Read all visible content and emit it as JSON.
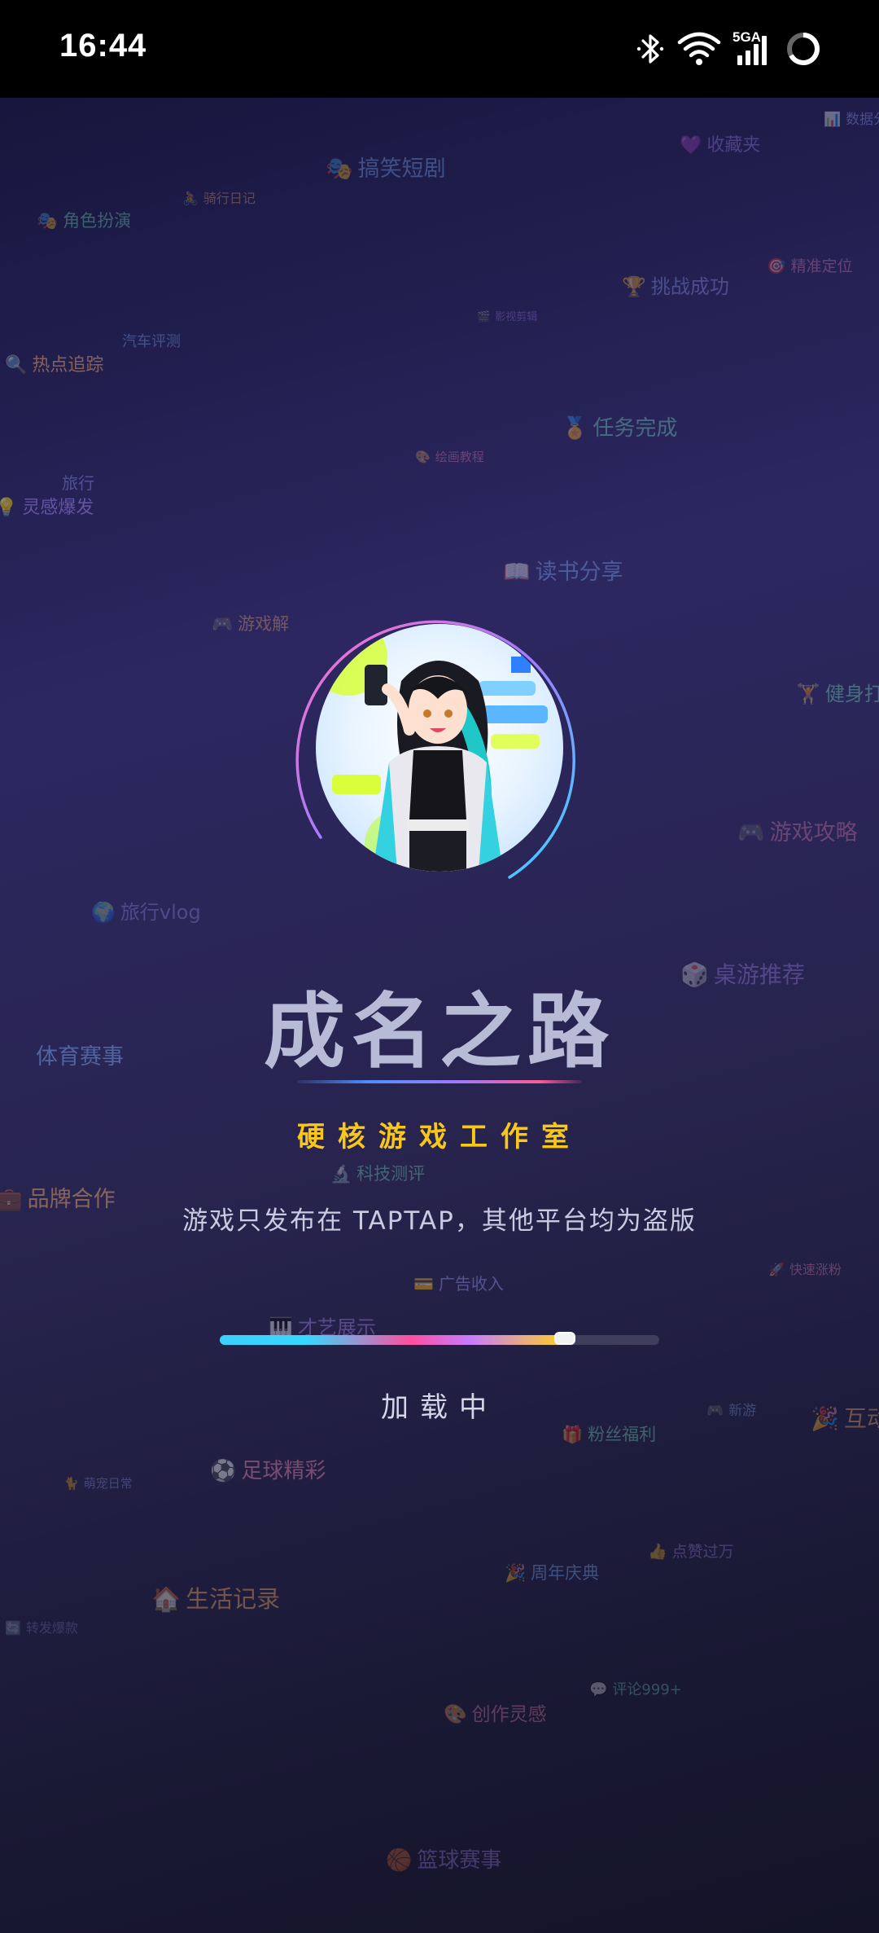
{
  "status_bar": {
    "time": "16:44",
    "network_label": "5GA",
    "icons": [
      "bluetooth-icon",
      "wifi-icon",
      "signal-icon",
      "battery-ring-icon"
    ]
  },
  "app": {
    "title": "成名之路",
    "studio": "硬核游戏工作室",
    "notice": "游戏只发布在 TAPTAP，其他平台均为盗版",
    "loading_label": "加载中",
    "progress": 0.79,
    "colors": {
      "studio": "#f8c71a",
      "progress_start": "#3ad0ff",
      "progress_mid": "#ff4fa0",
      "progress_end": "#ffd21f"
    }
  },
  "background_tags": [
    {
      "icon": "📊",
      "text": "数据分析"
    },
    {
      "icon": "💜",
      "text": "收藏夹"
    },
    {
      "icon": "🎭",
      "text": "搞笑短剧"
    },
    {
      "icon": "🚴",
      "text": "骑行日记"
    },
    {
      "icon": "🎭",
      "text": "角色扮演"
    },
    {
      "icon": "🎯",
      "text": "精准定位"
    },
    {
      "icon": "🏆",
      "text": "挑战成功"
    },
    {
      "icon": "🎬",
      "text": "影视剪辑"
    },
    {
      "icon": "",
      "text": "汽车评测"
    },
    {
      "icon": "🔍",
      "text": "热点追踪"
    },
    {
      "icon": "🏅",
      "text": "任务完成"
    },
    {
      "icon": "🎨",
      "text": "绘画教程"
    },
    {
      "icon": "",
      "text": "旅行"
    },
    {
      "icon": "💡",
      "text": "灵感爆发"
    },
    {
      "icon": "📖",
      "text": "读书分享"
    },
    {
      "icon": "🎮",
      "text": "游戏解"
    },
    {
      "icon": "🏋",
      "text": "健身打卡"
    },
    {
      "icon": "🎮",
      "text": "游戏攻略"
    },
    {
      "icon": "🌍",
      "text": "旅行vlog"
    },
    {
      "icon": "🎲",
      "text": "桌游推荐"
    },
    {
      "icon": "",
      "text": "体育赛事"
    },
    {
      "icon": "💼",
      "text": "品牌合作"
    },
    {
      "icon": "🔬",
      "text": "科技测评"
    },
    {
      "icon": "🚀",
      "text": "快速涨粉"
    },
    {
      "icon": "💳",
      "text": "广告收入"
    },
    {
      "icon": "🎹",
      "text": "才艺展示"
    },
    {
      "icon": "🎮",
      "text": "新游"
    },
    {
      "icon": "🎉",
      "text": "互动爆棚"
    },
    {
      "icon": "🎁",
      "text": "粉丝福利"
    },
    {
      "icon": "⚽",
      "text": "足球精彩"
    },
    {
      "icon": "🐈",
      "text": "萌宠日常"
    },
    {
      "icon": "👍",
      "text": "点赞过万"
    },
    {
      "icon": "🎉",
      "text": "周年庆典"
    },
    {
      "icon": "🏠",
      "text": "生活记录"
    },
    {
      "icon": "💬",
      "text": "评论999+"
    },
    {
      "icon": "🎨",
      "text": "创作灵感"
    },
    {
      "icon": "🔄",
      "text": "转发爆款"
    },
    {
      "icon": "🏀",
      "text": "篮球赛事"
    }
  ]
}
